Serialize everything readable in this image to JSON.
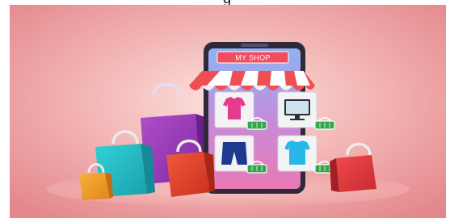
{
  "caption_fragment": "g",
  "shop": {
    "title": "MY SHOP"
  },
  "products": [
    {
      "name": "t-shirt-pink",
      "icon": "tshirt-icon",
      "color": "#e83a8c"
    },
    {
      "name": "monitor",
      "icon": "monitor-icon",
      "color": "#2a2f3a"
    },
    {
      "name": "shorts-navy",
      "icon": "shorts-icon",
      "color": "#1d3a8f"
    },
    {
      "name": "t-shirt-blue",
      "icon": "tshirt-icon",
      "color": "#29b6e8"
    }
  ],
  "colors": {
    "background_start": "#f8d3cf",
    "background_end": "#e5878a",
    "phone_frame": "#2f2a3a",
    "awning_red": "#ef4e52",
    "awning_white": "#ffffff",
    "basket_green": "#33a84a"
  }
}
